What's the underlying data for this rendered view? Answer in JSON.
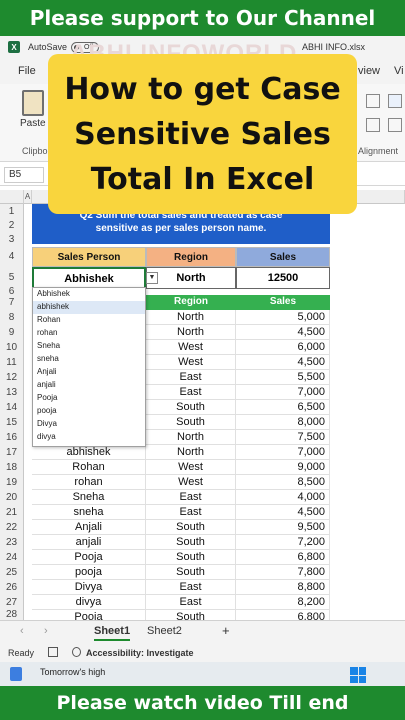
{
  "banner_top": "Please support to Our Channel",
  "banner_bottom": "Please watch video Till end",
  "titlebar": {
    "autosave_label": "AutoSave",
    "toggle_state": "Off",
    "filename": "ABHI INFO.xlsx",
    "watermark": "ABHI INFOWORLD"
  },
  "menu": {
    "file": "File",
    "view": "view",
    "vi": "Vi"
  },
  "ribbon": {
    "paste_label": "Paste",
    "clipboard_label": "Clipbo",
    "alignment_label": "Alignment"
  },
  "title_card": {
    "line1": "How to get Case",
    "line2": "Sensitive Sales",
    "line3": "Total In Excel"
  },
  "formula_bar": {
    "name_box": "B5"
  },
  "columns": {
    "a": "A"
  },
  "row_numbers": [
    "1",
    "2",
    "3",
    "4",
    "5",
    "6",
    "7",
    "8",
    "9",
    "10",
    "11",
    "12",
    "13",
    "14",
    "15",
    "16",
    "17",
    "18",
    "19",
    "20",
    "21",
    "22",
    "23",
    "24",
    "25",
    "26",
    "27",
    "28"
  ],
  "instruction_box": {
    "line1": "Q2 Sum the total sales and treated as case",
    "line2": "sensitive as per sales person name."
  },
  "lookup": {
    "hdr_person": "Sales Person",
    "hdr_region": "Region",
    "hdr_sales": "Sales",
    "person": "Abhishek",
    "region": "North",
    "sales": "12500"
  },
  "dropdown_items": [
    "Abhishek",
    "abhishek",
    "Rohan",
    "rohan",
    "Sneha",
    "sneha",
    "Anjali",
    "anjali",
    "Pooja",
    "pooja",
    "Divya",
    "divya"
  ],
  "table_headers": {
    "region": "Region",
    "sales": "Sales"
  },
  "table_rows": [
    {
      "person": "",
      "region": "North",
      "sales": "5,000"
    },
    {
      "person": "",
      "region": "North",
      "sales": "4,500"
    },
    {
      "person": "",
      "region": "West",
      "sales": "6,000"
    },
    {
      "person": "",
      "region": "West",
      "sales": "4,500"
    },
    {
      "person": "",
      "region": "East",
      "sales": "5,500"
    },
    {
      "person": "",
      "region": "East",
      "sales": "7,000"
    },
    {
      "person": "",
      "region": "South",
      "sales": "6,500"
    },
    {
      "person": "",
      "region": "South",
      "sales": "8,000"
    },
    {
      "person": "",
      "region": "North",
      "sales": "7,500"
    },
    {
      "person": "abhishek",
      "region": "North",
      "sales": "7,000"
    },
    {
      "person": "Rohan",
      "region": "West",
      "sales": "9,000"
    },
    {
      "person": "rohan",
      "region": "West",
      "sales": "8,500"
    },
    {
      "person": "Sneha",
      "region": "East",
      "sales": "4,000"
    },
    {
      "person": "sneha",
      "region": "East",
      "sales": "4,500"
    },
    {
      "person": "Anjali",
      "region": "South",
      "sales": "9,500"
    },
    {
      "person": "anjali",
      "region": "South",
      "sales": "7,200"
    },
    {
      "person": "Pooja",
      "region": "South",
      "sales": "6,800"
    },
    {
      "person": "pooja",
      "region": "South",
      "sales": "7,800"
    },
    {
      "person": "Divya",
      "region": "East",
      "sales": "8,800"
    },
    {
      "person": "divya",
      "region": "East",
      "sales": "8,200"
    },
    {
      "person": "Pooja",
      "region": "South",
      "sales": "6,800"
    }
  ],
  "sheet_tabs": [
    "Sheet1",
    "Sheet2"
  ],
  "add_sheet": "+",
  "status": {
    "ready": "Ready",
    "accessibility": "Accessibility: Investigate"
  },
  "taskbar": {
    "weather": "Tomorrow's high"
  },
  "colors": {
    "banner_green": "#1e8a2e",
    "title_yellow": "#f9d53d",
    "instruction_blue": "#1f5ec8",
    "table_header_green": "#35b050",
    "hdr_person_bg": "#f7d07a",
    "hdr_region_bg": "#f4b183",
    "hdr_sales_bg": "#8faadc"
  }
}
